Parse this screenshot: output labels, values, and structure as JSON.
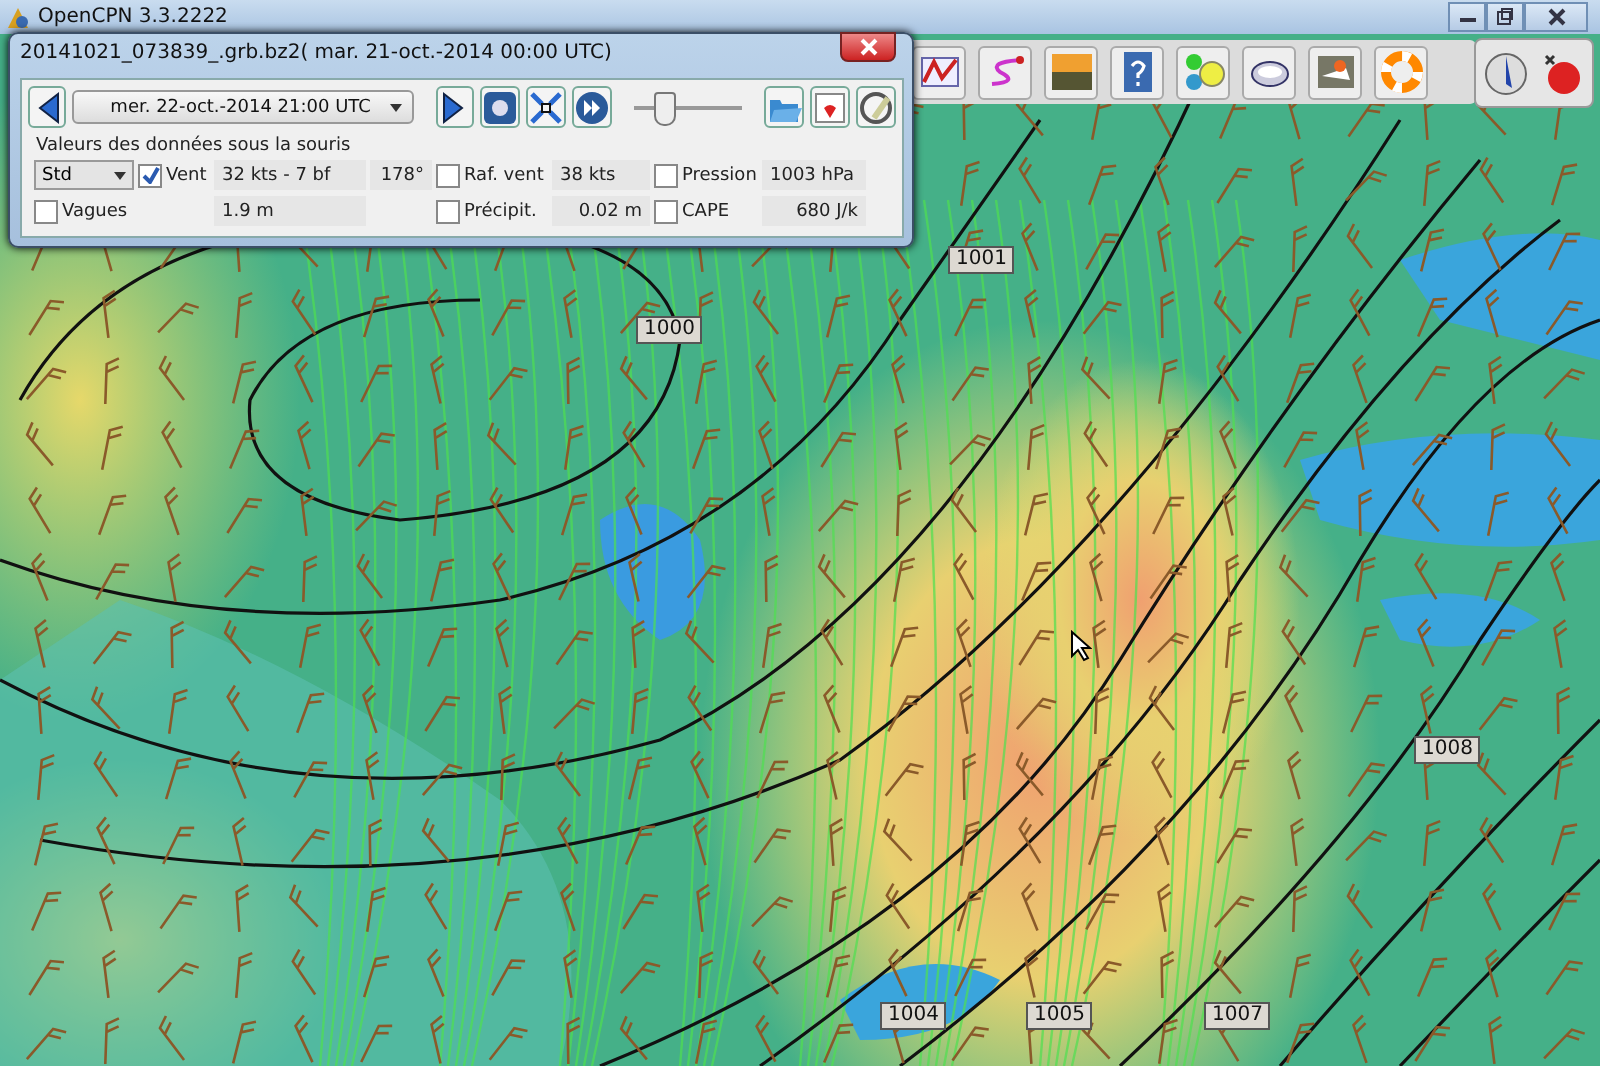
{
  "window": {
    "title": "OpenCPN 3.3.2222"
  },
  "grib_dialog": {
    "title": "20141021_073839_.grb.bz2( mar. 21-oct.-2014 00:00  UTC)",
    "time": "mer. 22-oct.-2014 21:00  UTC",
    "slider": {
      "level": 0.28
    },
    "section_label": "Valeurs des données sous la souris",
    "rows": [
      [
        {
          "kind": "select",
          "text": "Std"
        },
        {
          "kind": "checkbox",
          "text": "Vent",
          "checked": true
        },
        {
          "kind": "value",
          "text": "32 kts -  7 bf"
        },
        {
          "kind": "value",
          "text": "178°"
        },
        {
          "kind": "checkbox",
          "text": "Raf. vent",
          "checked": false
        },
        {
          "kind": "value",
          "text": "38 kts"
        },
        {
          "kind": "checkbox",
          "text": "Pression",
          "checked": false
        },
        {
          "kind": "value",
          "text": "1003 hPa"
        }
      ],
      [
        {
          "kind": "checkbox",
          "text": "Vagues",
          "checked": false
        },
        {
          "kind": "blank",
          "text": ""
        },
        {
          "kind": "value",
          "text": "1.9 m"
        },
        {
          "kind": "blank",
          "text": ""
        },
        {
          "kind": "checkbox",
          "text": "Précipit.",
          "checked": false
        },
        {
          "kind": "value",
          "text": "0.02 m"
        },
        {
          "kind": "checkbox",
          "text": "CAPE",
          "checked": false
        },
        {
          "kind": "value",
          "text": "680 J/k"
        }
      ]
    ]
  },
  "isobar_labels": [
    "1000",
    "1001",
    "1008",
    "1004",
    "1005",
    "1007"
  ]
}
